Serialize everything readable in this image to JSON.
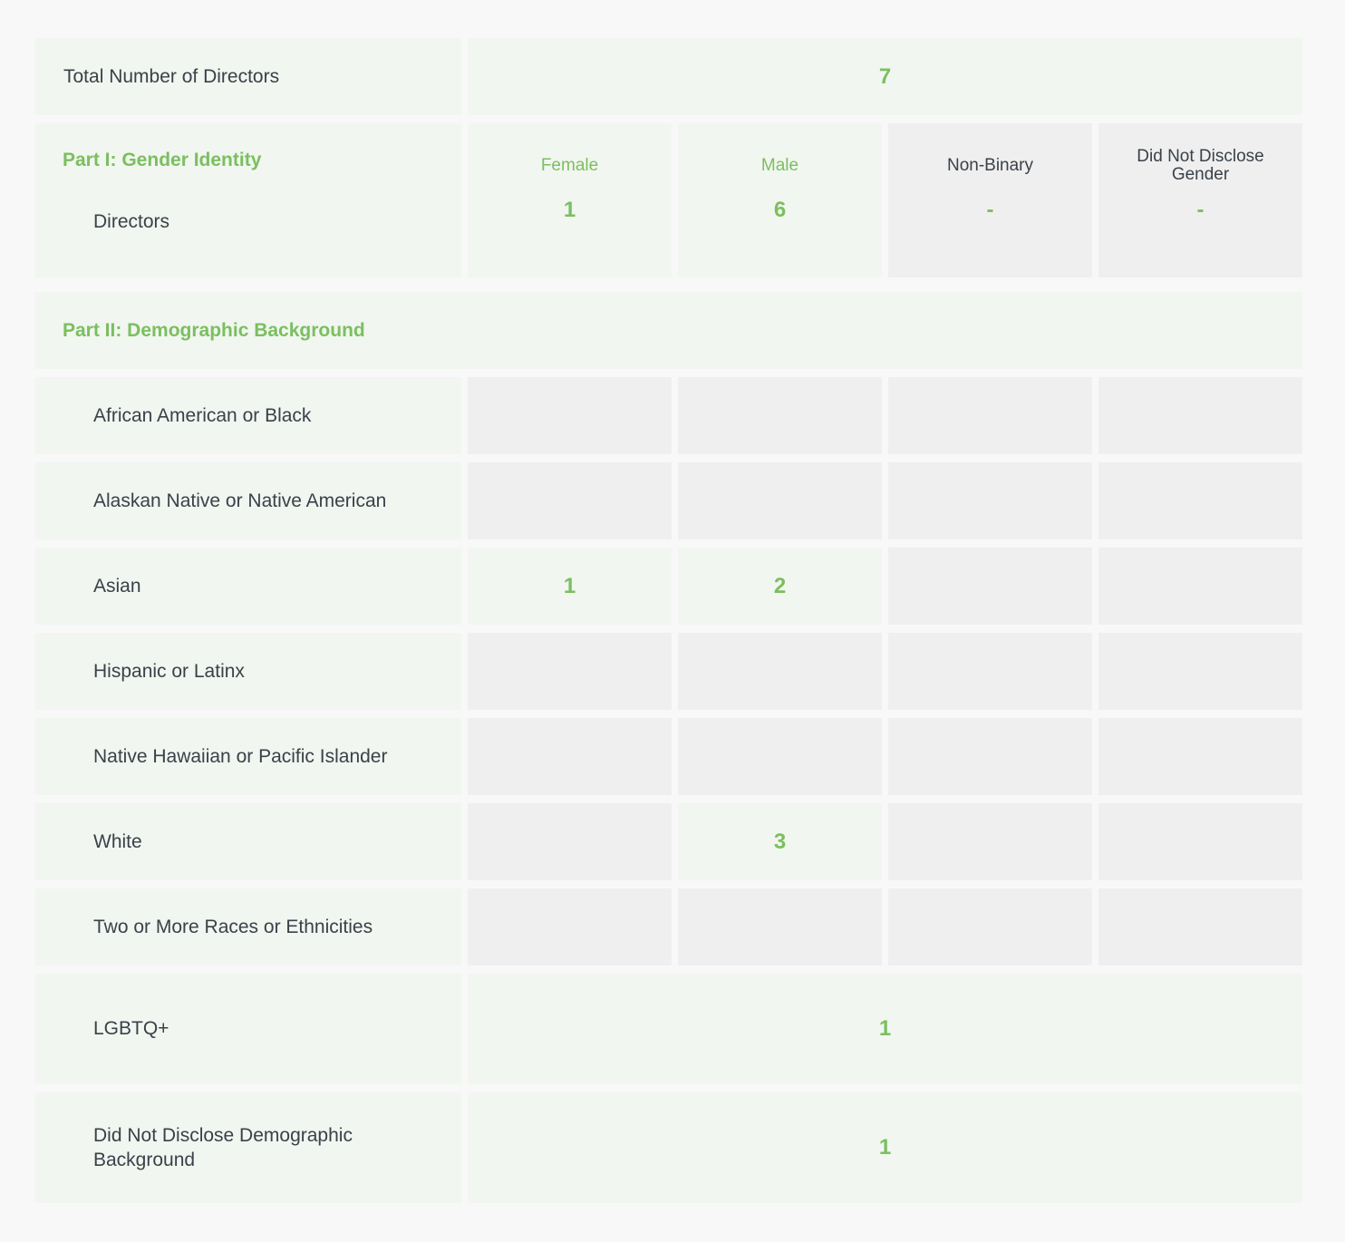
{
  "total": {
    "label": "Total Number of Directors",
    "value": "7"
  },
  "part1": {
    "title": "Part I: Gender Identity",
    "row_label": "Directors",
    "columns": [
      {
        "header": "Female",
        "value": "1"
      },
      {
        "header": "Male",
        "value": "6"
      },
      {
        "header": "Non-Binary",
        "value": "-"
      },
      {
        "header": "Did Not Disclose Gender",
        "value": "-"
      }
    ]
  },
  "part2": {
    "title": "Part II: Demographic Background",
    "rows": [
      {
        "label": "African American or Black",
        "values": [
          "",
          "",
          "",
          ""
        ]
      },
      {
        "label": "Alaskan Native or Native American",
        "values": [
          "",
          "",
          "",
          ""
        ]
      },
      {
        "label": "Asian",
        "values": [
          "1",
          "2",
          "",
          ""
        ]
      },
      {
        "label": "Hispanic or Latinx",
        "values": [
          "",
          "",
          "",
          ""
        ]
      },
      {
        "label": "Native Hawaiian or Pacific Islander",
        "values": [
          "",
          "",
          "",
          ""
        ]
      },
      {
        "label": "White",
        "values": [
          "",
          "3",
          "",
          ""
        ]
      },
      {
        "label": "Two or More Races or Ethnicities",
        "values": [
          "",
          "",
          "",
          ""
        ]
      }
    ],
    "lgbtq": {
      "label": "LGBTQ+",
      "value": "1"
    },
    "undisclosed": {
      "label": "Did Not Disclose Demographic Background",
      "value": "1"
    }
  },
  "colors": {
    "accent_green": "#7bbf5f",
    "text_dark": "#3a4149",
    "cell_green": "#f1f6f0",
    "cell_gray": "#efefef",
    "page_bg": "#f8f8f8"
  }
}
